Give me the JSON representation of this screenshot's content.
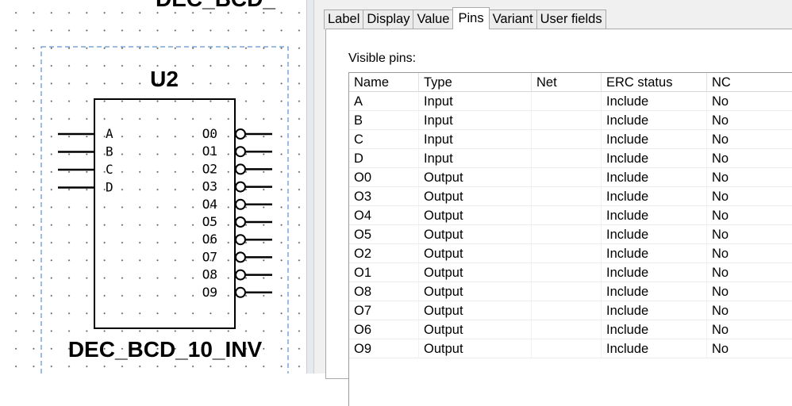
{
  "component": {
    "ref": "U2",
    "part_name": "DEC_BCD_10_INV",
    "top_label_partial": "DEC_BCD_",
    "input_pins": [
      "A",
      "B",
      "C",
      "D"
    ],
    "output_pins": [
      "O0",
      "O1",
      "O2",
      "O3",
      "O4",
      "O5",
      "O6",
      "O7",
      "O8",
      "O9"
    ]
  },
  "tabs": [
    {
      "label": "Label",
      "active": false
    },
    {
      "label": "Display",
      "active": false
    },
    {
      "label": "Value",
      "active": false
    },
    {
      "label": "Pins",
      "active": true
    },
    {
      "label": "Variant",
      "active": false
    },
    {
      "label": "User fields",
      "active": false
    }
  ],
  "pins_panel": {
    "visible_pins_label": "Visible pins:",
    "columns": [
      "Name",
      "Type",
      "Net",
      "ERC status",
      "NC"
    ],
    "rows": [
      [
        "A",
        "Input",
        "",
        "Include",
        "No"
      ],
      [
        "B",
        "Input",
        "",
        "Include",
        "No"
      ],
      [
        "C",
        "Input",
        "",
        "Include",
        "No"
      ],
      [
        "D",
        "Input",
        "",
        "Include",
        "No"
      ],
      [
        "O0",
        "Output",
        "",
        "Include",
        "No"
      ],
      [
        "O3",
        "Output",
        "",
        "Include",
        "No"
      ],
      [
        "O4",
        "Output",
        "",
        "Include",
        "No"
      ],
      [
        "O5",
        "Output",
        "",
        "Include",
        "No"
      ],
      [
        "O2",
        "Output",
        "",
        "Include",
        "No"
      ],
      [
        "O1",
        "Output",
        "",
        "Include",
        "No"
      ],
      [
        "O8",
        "Output",
        "",
        "Include",
        "No"
      ],
      [
        "O7",
        "Output",
        "",
        "Include",
        "No"
      ],
      [
        "O6",
        "Output",
        "",
        "Include",
        "No"
      ],
      [
        "O9",
        "Output",
        "",
        "Include",
        "No"
      ]
    ]
  }
}
